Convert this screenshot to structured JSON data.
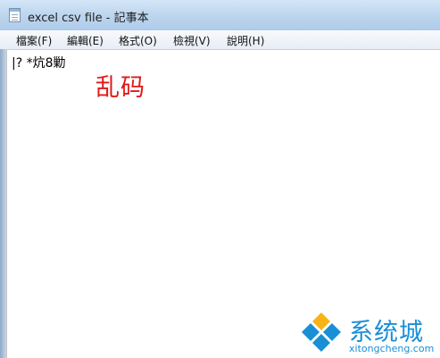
{
  "window": {
    "title": "excel csv file - 記事本"
  },
  "menu": {
    "items": [
      {
        "label": "檔案(F)"
      },
      {
        "label": "編輯(E)"
      },
      {
        "label": "格式(O)"
      },
      {
        "label": "檢視(V)"
      },
      {
        "label": "說明(H)"
      }
    ]
  },
  "document": {
    "text": "|? *炕8勦"
  },
  "annotation": {
    "text": "乱码",
    "color": "#e01818"
  },
  "watermark": {
    "title": "系统城",
    "url": "xitongcheng.com",
    "color": "#1a8fd6"
  }
}
